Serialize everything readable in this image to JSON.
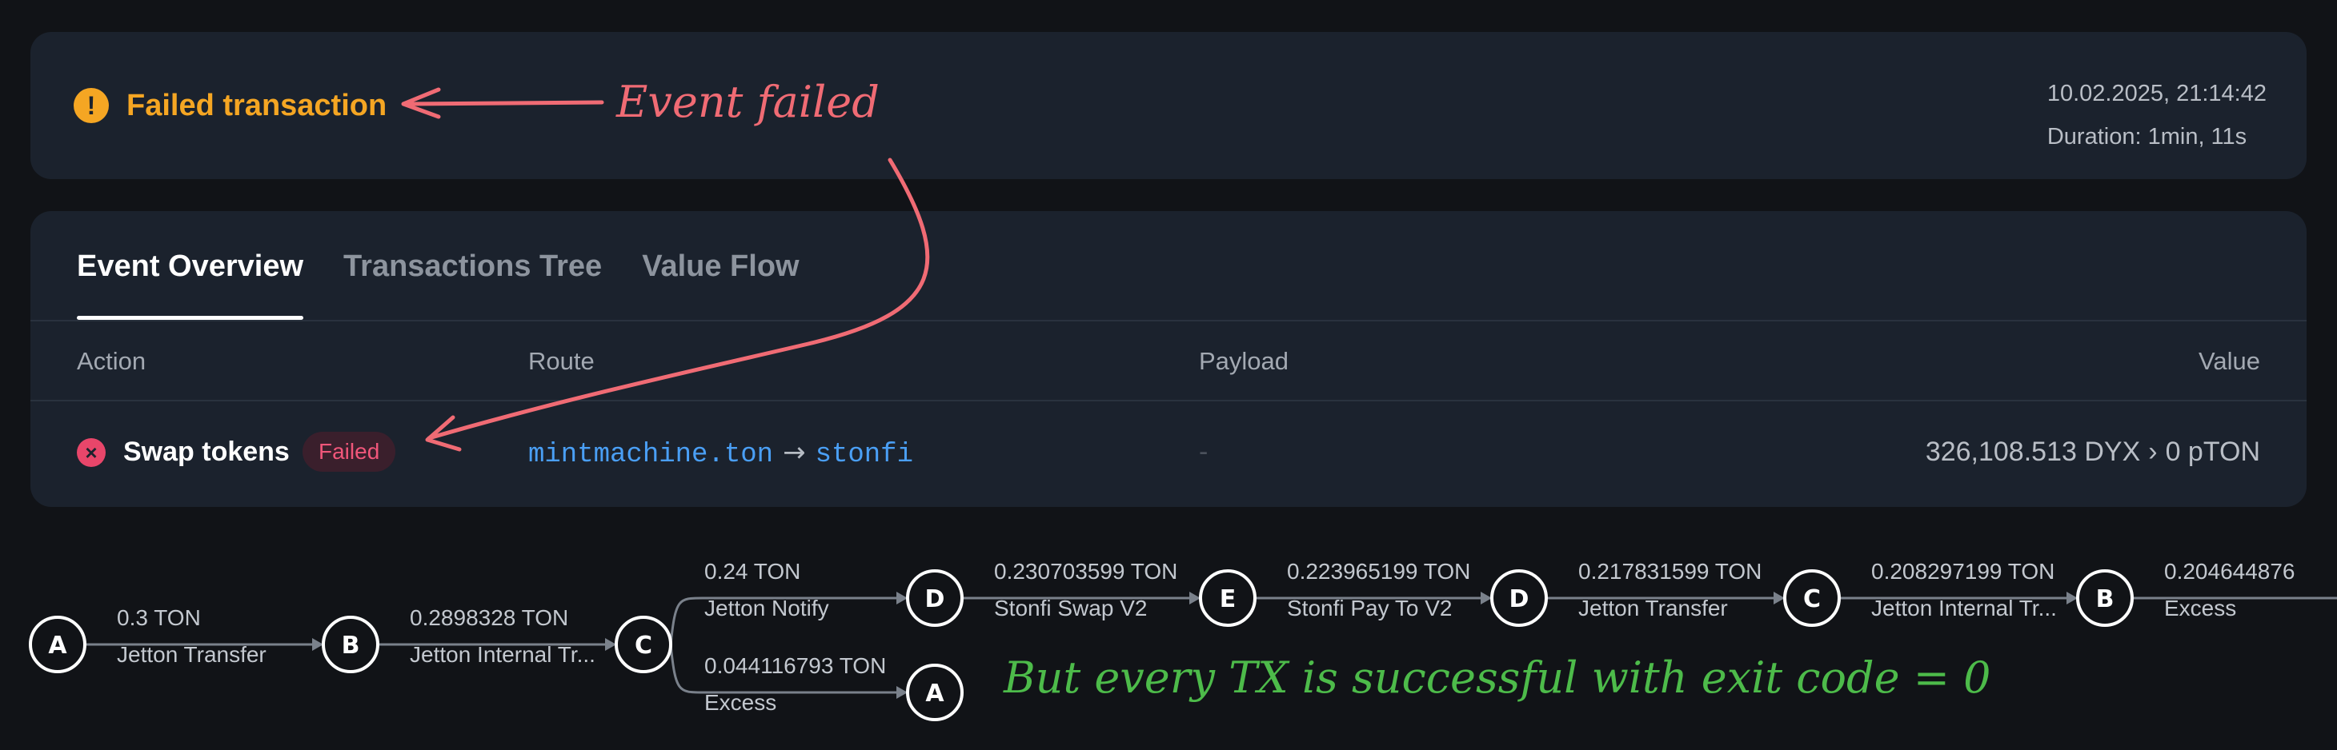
{
  "status": {
    "icon": "warning-icon",
    "label": "Failed transaction",
    "datetime": "10.02.2025, 21:14:42",
    "duration": "Duration: 1min, 11s"
  },
  "tabs": [
    {
      "label": "Event Overview",
      "active": true
    },
    {
      "label": "Transactions Tree",
      "active": false
    },
    {
      "label": "Value Flow",
      "active": false
    }
  ],
  "table": {
    "headers": {
      "action": "Action",
      "route": "Route",
      "payload": "Payload",
      "value": "Value"
    },
    "row": {
      "status_icon": "x-circle-icon",
      "action": "Swap tokens",
      "badge": "Failed",
      "route_from": "mintmachine.ton",
      "route_arrow": "→",
      "route_to": "stonfi",
      "payload": "-",
      "value_in": "326,108.513 DYX",
      "value_sep": "›",
      "value_out": "0 pTON"
    }
  },
  "flow": {
    "nodes": [
      "A",
      "B",
      "C",
      "D",
      "E",
      "D",
      "C",
      "B",
      "A"
    ],
    "edges": [
      {
        "amount": "0.3 TON",
        "op": "Jetton Transfer"
      },
      {
        "amount": "0.2898328 TON",
        "op": "Jetton Internal Tr..."
      },
      {
        "amount": "0.24 TON",
        "op": "Jetton Notify"
      },
      {
        "amount": "0.044116793 TON",
        "op": "Excess"
      },
      {
        "amount": "0.230703599 TON",
        "op": "Stonfi Swap V2"
      },
      {
        "amount": "0.223965199 TON",
        "op": "Stonfi Pay To V2"
      },
      {
        "amount": "0.217831599 TON",
        "op": "Jetton Transfer"
      },
      {
        "amount": "0.208297199 TON",
        "op": "Jetton Internal Tr..."
      },
      {
        "amount": "0.204644876",
        "op": "Excess"
      }
    ]
  },
  "annotations": {
    "event_failed": "Event failed",
    "success_note": "But every TX is successful with exit code = 0",
    "color_red": "#f06b74",
    "color_green": "#4dbb4a"
  },
  "colors": {
    "warning": "#f5a623",
    "error": "#e8466a",
    "link": "#4a9ff5",
    "card": "#1b222d",
    "background": "#111317"
  }
}
